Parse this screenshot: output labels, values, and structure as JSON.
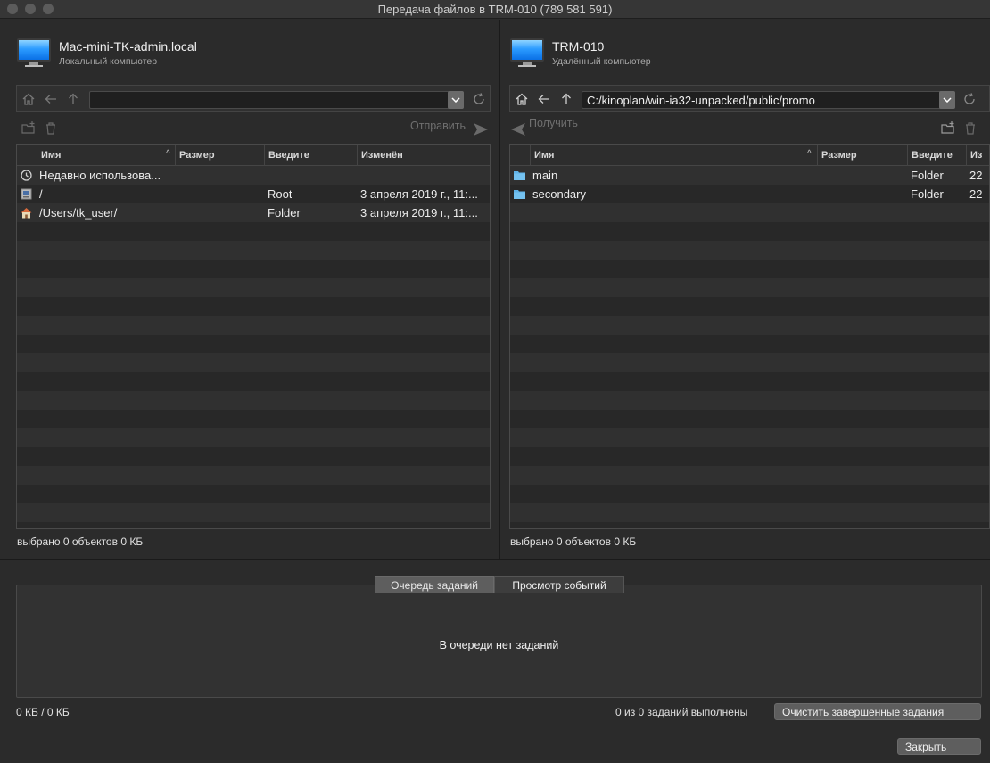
{
  "window": {
    "title": "Передача файлов в TRM-010 (789 581 591)"
  },
  "colors": {
    "accent_monitor": "#2b9bff",
    "folder": "#5fb3e8"
  },
  "local": {
    "host_name": "Mac-mini-TK-admin.local",
    "host_sub": "Локальный компьютер",
    "path": "",
    "send_label": "Отправить",
    "columns": {
      "name": "Имя",
      "size": "Размер",
      "type": "Введите",
      "modified": "Изменён"
    },
    "rows": [
      {
        "icon": "recent-clock-icon",
        "name": "Недавно использова...",
        "size": "",
        "type": "",
        "modified": ""
      },
      {
        "icon": "drive-icon",
        "name": "/",
        "size": "",
        "type": "Root",
        "modified": "3 апреля 2019 г., 11:..."
      },
      {
        "icon": "home-icon",
        "name": "/Users/tk_user/",
        "size": "",
        "type": "Folder",
        "modified": "3 апреля 2019 г., 11:..."
      }
    ],
    "status": "выбрано 0 объектов   0 КБ"
  },
  "remote": {
    "host_name": "TRM-010",
    "host_sub": "Удалённый компьютер",
    "path": "C:/kinoplan/win-ia32-unpacked/public/promo",
    "receive_label": "Получить",
    "columns": {
      "name": "Имя",
      "size": "Размер",
      "type": "Введите",
      "modified": "Из"
    },
    "rows": [
      {
        "icon": "folder-icon",
        "name": "main",
        "size": "",
        "type": "Folder",
        "modified": "22"
      },
      {
        "icon": "folder-icon",
        "name": "secondary",
        "size": "",
        "type": "Folder",
        "modified": "22"
      }
    ],
    "status": "выбрано 0 объектов   0 КБ"
  },
  "tasks": {
    "tab_queue": "Очередь заданий",
    "tab_events": "Просмотр событий",
    "empty_message": "В очереди нет заданий",
    "transfer_total": "0 КБ / 0 КБ",
    "done_text": "0 из 0 заданий выполнены",
    "clear_button": "Очистить завершенные задания",
    "close_button": "Закрыть"
  }
}
